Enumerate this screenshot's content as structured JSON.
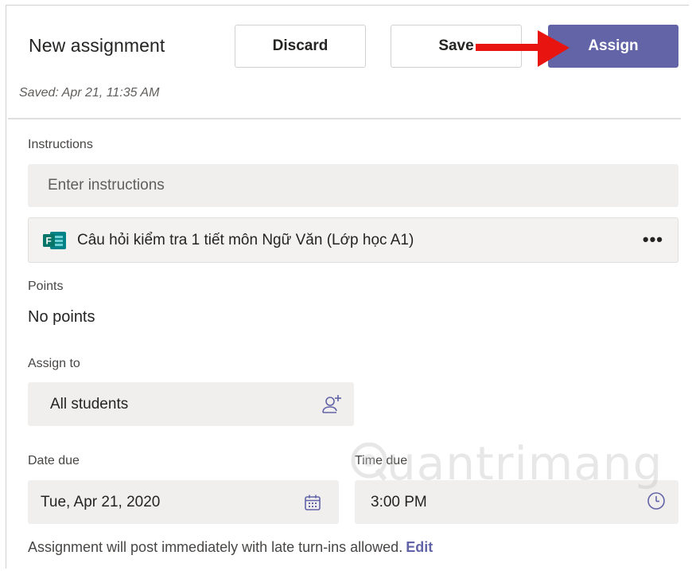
{
  "header": {
    "title": "New assignment",
    "saved_status": "Saved: Apr 21, 11:35 AM",
    "discard_label": "Discard",
    "save_label": "Save",
    "assign_label": "Assign"
  },
  "instructions": {
    "label": "Instructions",
    "placeholder": "Enter instructions"
  },
  "attachment": {
    "icon": "forms-icon",
    "name": "Câu hỏi kiểm tra 1 tiết môn Ngữ Văn (Lớp học A1)",
    "more_label": "•••"
  },
  "points": {
    "label": "Points",
    "value": "No points"
  },
  "assign_to": {
    "label": "Assign to",
    "value": "All students",
    "icon": "add-person-icon"
  },
  "date_due": {
    "label": "Date due",
    "value": "Tue, Apr 21, 2020",
    "icon": "calendar-icon"
  },
  "time_due": {
    "label": "Time due",
    "value": "3:00 PM",
    "icon": "clock-icon"
  },
  "footer": {
    "note": "Assignment will post immediately with late turn-ins allowed.",
    "edit_label": "Edit"
  },
  "watermark": {
    "text": "uantrimang"
  },
  "colors": {
    "accent": "#6264a7",
    "arrow": "#e8140f",
    "field_bg": "#f0efee"
  }
}
